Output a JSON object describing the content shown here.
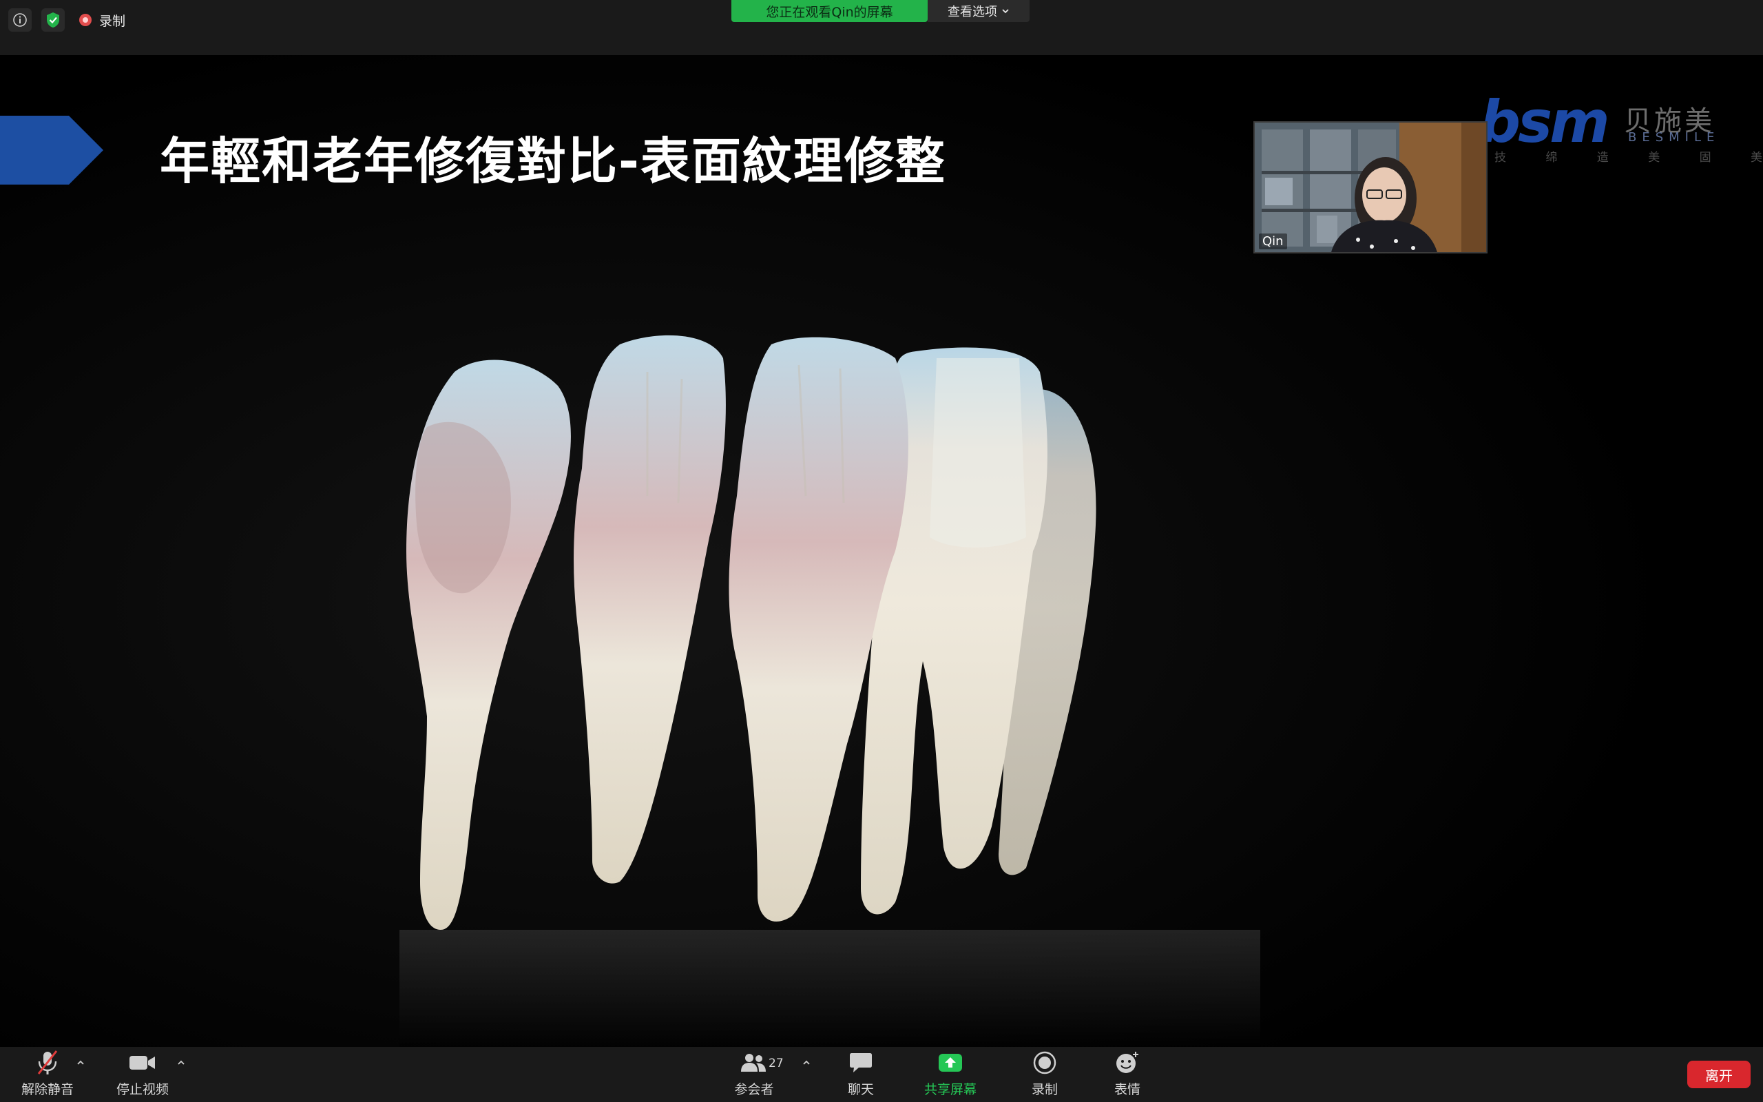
{
  "topbar": {
    "info_icon": "info-icon",
    "security_icon": "shield-check-icon",
    "record_icon": "record-dot-icon",
    "record_label": "录制",
    "viewing_banner": "您正在观看Qin的屏幕",
    "view_options_label": "查看选项",
    "view_options_icon": "chevron-down-icon"
  },
  "slide": {
    "title": "年輕和老年修復對比-表面紋理修整",
    "accent_color": "#1d4fa3",
    "brand": {
      "mark": "bsm",
      "cn_name": "贝施美",
      "en_name": "BESMILE",
      "tagline": "技 绵 造 美 固 美 容"
    },
    "image_subject": "teeth-model-photo"
  },
  "speaker": {
    "name": "Qin"
  },
  "toolbar": {
    "unmute_label": "解除静音",
    "unmute_icon": "microphone-muted-icon",
    "stop_video_label": "停止视频",
    "stop_video_icon": "video-camera-icon",
    "participants_label": "参会者",
    "participants_count": "27",
    "participants_icon": "participants-icon",
    "chat_label": "聊天",
    "chat_icon": "chat-bubble-icon",
    "share_label": "共享屏幕",
    "share_icon": "share-screen-icon",
    "record_label": "录制",
    "record_icon": "record-icon",
    "reactions_label": "表情",
    "reactions_icon": "emoji-icon",
    "leave_label": "离开",
    "share_color": "#25c756",
    "leave_color": "#d9272d"
  }
}
